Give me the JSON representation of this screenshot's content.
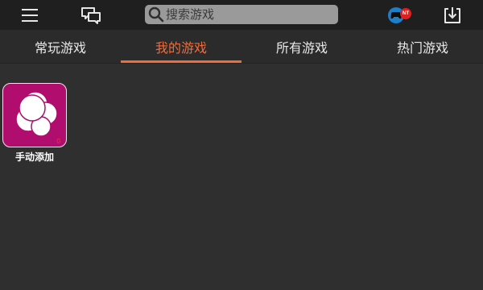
{
  "header": {
    "search_placeholder": "搜索游戏",
    "controller_badge": "NT",
    "icons": [
      "menu-icon",
      "chat-icon",
      "search-icon",
      "gamepad-icon",
      "download-icon"
    ]
  },
  "tabs": [
    {
      "label": "常玩游戏",
      "active": false
    },
    {
      "label": "我的游戏",
      "active": true
    },
    {
      "label": "所有游戏",
      "active": false
    },
    {
      "label": "热门游戏",
      "active": false
    }
  ],
  "games": [
    {
      "label": "手动添加",
      "count": "0",
      "icon": "add-game-bubbles-icon"
    }
  ],
  "colors": {
    "accent": "#f26b3a",
    "top_bar": "#1f1f1f",
    "background": "#2f2f2f",
    "tile": "#b00d6e",
    "badge": "#e02020",
    "search_bg": "#9a9a9a"
  }
}
